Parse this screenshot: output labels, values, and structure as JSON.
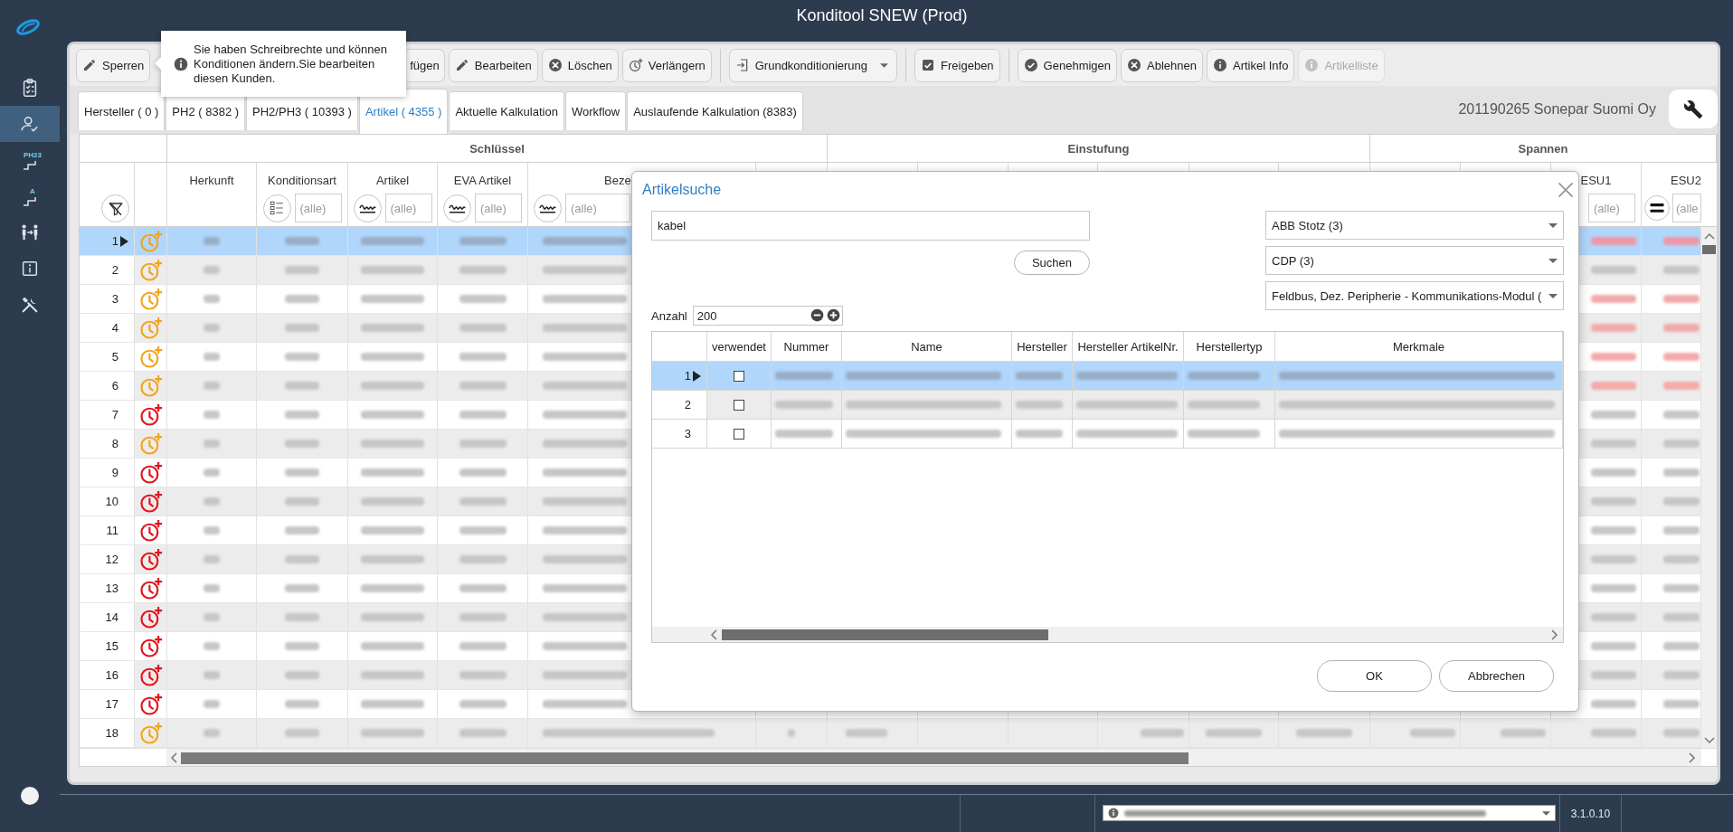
{
  "window": {
    "title": "Konditool SNEW (Prod)"
  },
  "sidebar": {
    "items": [
      {
        "selected": false
      },
      {
        "selected": true
      },
      {
        "selected": false,
        "text": "PH23"
      },
      {
        "selected": false,
        "text": "A"
      },
      {
        "selected": false
      },
      {
        "selected": false
      },
      {
        "selected": false
      }
    ]
  },
  "toolbar": {
    "groups": [
      {
        "buttons": [
          {
            "label": "Sperren",
            "kind": "edit",
            "disabled": false
          },
          {
            "label": "fügen",
            "kind": "plain",
            "disabled": false
          },
          {
            "label": "Bearbeiten",
            "kind": "edit",
            "disabled": false
          },
          {
            "label": "Löschen",
            "kind": "delete",
            "disabled": false
          },
          {
            "label": "Verlängern",
            "kind": "extend",
            "disabled": false
          }
        ]
      },
      {
        "buttons": [
          {
            "label": "Grundkonditionierung",
            "kind": "menu",
            "disabled": false
          }
        ]
      },
      {
        "buttons": [
          {
            "label": "Freigeben",
            "kind": "release",
            "disabled": false
          }
        ]
      },
      {
        "buttons": [
          {
            "label": "Genehmigen",
            "kind": "approve",
            "disabled": false
          },
          {
            "label": "Ablehnen",
            "kind": "delete",
            "disabled": false
          },
          {
            "label": "Artikel Info",
            "kind": "info",
            "disabled": false
          },
          {
            "label": "Artikelliste",
            "kind": "info",
            "disabled": true
          }
        ]
      }
    ]
  },
  "tooltip": {
    "text": "Sie haben Schreibrechte und können Konditionen ändern.Sie bearbeiten diesen Kunden."
  },
  "tabs": [
    {
      "label": "Hersteller ( 0 )",
      "selected": false
    },
    {
      "label": "PH2 ( 8382 )",
      "selected": false
    },
    {
      "label": "PH2/PH3 ( 10393 )",
      "selected": false
    },
    {
      "label": "Artikel ( 4355 )",
      "selected": true
    },
    {
      "label": "Aktuelle Kalkulation",
      "selected": false
    },
    {
      "label": "Workflow",
      "selected": false
    },
    {
      "label": "Auslaufende Kalkulation (8383)",
      "selected": false
    }
  ],
  "customer": "201190265 Sonepar Suomi Oy",
  "table": {
    "groups": [
      {
        "label": "Schlüssel",
        "columns": [
          {
            "label": "Herkunft"
          },
          {
            "label": "Konditionsart",
            "filter": {
              "kind": "list",
              "placeholder": "(alle)"
            }
          },
          {
            "label": "Artikel",
            "filter": {
              "kind": "text",
              "placeholder": "(alle)"
            }
          },
          {
            "label": "EVA Artikel",
            "filter": {
              "kind": "text",
              "placeholder": "(alle)"
            }
          },
          {
            "label": "Beze",
            "filter": {
              "kind": "text",
              "placeholder": "(alle)"
            }
          },
          {}
        ]
      },
      {
        "label": "Einstufung",
        "columns": [
          {},
          {},
          {},
          {},
          {},
          {}
        ]
      },
      {
        "label": "Spannen",
        "columns": [
          {},
          {},
          {
            "label": "ESU1",
            "filter": {
              "placeholder": "(alle)"
            }
          },
          {
            "label": "ESU2",
            "filter": {
              "kind": "equals",
              "placeholder": "(alle"
            }
          }
        ]
      }
    ],
    "rows": [
      {
        "number": "1",
        "selected": true,
        "color": "#f5a31a",
        "negative": true,
        "cells": [
          true,
          true,
          true,
          true,
          true,
          null,
          null,
          null,
          null,
          null,
          null,
          null,
          null,
          null,
          true,
          true
        ]
      },
      {
        "number": "2",
        "selected": false,
        "color": "#f5a31a",
        "negative": false,
        "cells": [
          true,
          true,
          true,
          true,
          true,
          null,
          null,
          null,
          null,
          null,
          null,
          null,
          null,
          null,
          true,
          true
        ]
      },
      {
        "number": "3",
        "selected": false,
        "color": "#f5a31a",
        "negative": true,
        "cells": [
          true,
          true,
          true,
          true,
          true,
          null,
          null,
          null,
          null,
          null,
          null,
          null,
          null,
          null,
          true,
          true
        ]
      },
      {
        "number": "4",
        "selected": false,
        "color": "#f5a31a",
        "negative": true,
        "cells": [
          true,
          true,
          true,
          true,
          true,
          null,
          null,
          null,
          null,
          null,
          null,
          null,
          null,
          null,
          true,
          true
        ]
      },
      {
        "number": "5",
        "selected": false,
        "color": "#f5a31a",
        "negative": true,
        "cells": [
          true,
          true,
          true,
          true,
          true,
          null,
          null,
          null,
          null,
          null,
          null,
          null,
          null,
          null,
          true,
          true
        ]
      },
      {
        "number": "6",
        "selected": false,
        "color": "#f5a31a",
        "negative": true,
        "cells": [
          true,
          true,
          true,
          true,
          true,
          null,
          null,
          null,
          null,
          null,
          null,
          null,
          null,
          null,
          true,
          true
        ]
      },
      {
        "number": "7",
        "selected": false,
        "color": "#e5121b",
        "negative": false,
        "cells": [
          true,
          true,
          true,
          true,
          true,
          null,
          null,
          null,
          null,
          null,
          null,
          null,
          null,
          null,
          true,
          true
        ]
      },
      {
        "number": "8",
        "selected": false,
        "color": "#f5a31a",
        "negative": false,
        "cells": [
          true,
          true,
          true,
          true,
          true,
          null,
          null,
          null,
          null,
          null,
          null,
          null,
          null,
          null,
          true,
          true
        ]
      },
      {
        "number": "9",
        "selected": false,
        "color": "#e5121b",
        "negative": false,
        "cells": [
          true,
          true,
          true,
          true,
          true,
          null,
          null,
          null,
          null,
          null,
          null,
          null,
          null,
          null,
          true,
          true
        ]
      },
      {
        "number": "10",
        "selected": false,
        "color": "#e5121b",
        "negative": false,
        "cells": [
          true,
          true,
          true,
          true,
          true,
          null,
          null,
          null,
          null,
          null,
          null,
          null,
          null,
          null,
          true,
          true
        ]
      },
      {
        "number": "11",
        "selected": false,
        "color": "#e5121b",
        "negative": false,
        "cells": [
          true,
          true,
          true,
          true,
          true,
          null,
          null,
          null,
          null,
          null,
          null,
          null,
          null,
          null,
          true,
          true
        ]
      },
      {
        "number": "12",
        "selected": false,
        "color": "#e5121b",
        "negative": false,
        "cells": [
          true,
          true,
          true,
          true,
          true,
          null,
          null,
          null,
          null,
          null,
          null,
          null,
          null,
          null,
          true,
          true
        ]
      },
      {
        "number": "13",
        "selected": false,
        "color": "#e5121b",
        "negative": false,
        "cells": [
          true,
          true,
          true,
          true,
          true,
          null,
          null,
          null,
          null,
          null,
          null,
          null,
          null,
          null,
          true,
          true
        ]
      },
      {
        "number": "14",
        "selected": false,
        "color": "#e5121b",
        "negative": false,
        "cells": [
          true,
          true,
          true,
          true,
          true,
          null,
          null,
          null,
          null,
          null,
          null,
          null,
          null,
          null,
          true,
          true
        ]
      },
      {
        "number": "15",
        "selected": false,
        "color": "#e5121b",
        "negative": false,
        "cells": [
          true,
          true,
          true,
          true,
          true,
          null,
          null,
          null,
          null,
          null,
          null,
          null,
          null,
          null,
          true,
          true
        ]
      },
      {
        "number": "16",
        "selected": false,
        "color": "#e5121b",
        "negative": false,
        "cells": [
          true,
          true,
          true,
          true,
          true,
          null,
          null,
          null,
          null,
          null,
          null,
          null,
          null,
          null,
          true,
          true
        ]
      },
      {
        "number": "17",
        "selected": false,
        "color": "#e5121b",
        "negative": false,
        "cells": [
          true,
          true,
          true,
          true,
          true,
          null,
          null,
          null,
          null,
          null,
          null,
          null,
          null,
          null,
          true,
          true
        ]
      },
      {
        "number": "18",
        "selected": false,
        "color": "#f5a31a",
        "negative": false,
        "cells": [
          true,
          true,
          true,
          true,
          true,
          true,
          true,
          null,
          null,
          true,
          true,
          true,
          true,
          true,
          true,
          true
        ]
      }
    ]
  },
  "dialog": {
    "title": "Artikelsuche",
    "search": {
      "value": "kabel"
    },
    "search_button": "Suchen",
    "filters": [
      {
        "value": "ABB Stotz (3)"
      },
      {
        "value": "CDP (3)"
      },
      {
        "value": "Feldbus, Dez. Peripherie - Kommunikations-Modul ("
      }
    ],
    "count": {
      "label": "Anzahl",
      "value": "200"
    },
    "grid": {
      "columns": [
        "verwendet",
        "Nummer",
        "Name",
        "Hersteller",
        "Hersteller ArtikelNr.",
        "Herstellertyp",
        "Merkmale"
      ],
      "rows": [
        {
          "number": "1",
          "selected": true,
          "checked": false
        },
        {
          "number": "2",
          "selected": false,
          "checked": false
        },
        {
          "number": "3",
          "selected": false,
          "checked": false
        }
      ]
    },
    "buttons": [
      {
        "label": "OK"
      },
      {
        "label": "Abbrechen"
      }
    ]
  },
  "status_bar": {
    "message": {
      "blurred": true
    },
    "version": "3.1.0.10"
  }
}
